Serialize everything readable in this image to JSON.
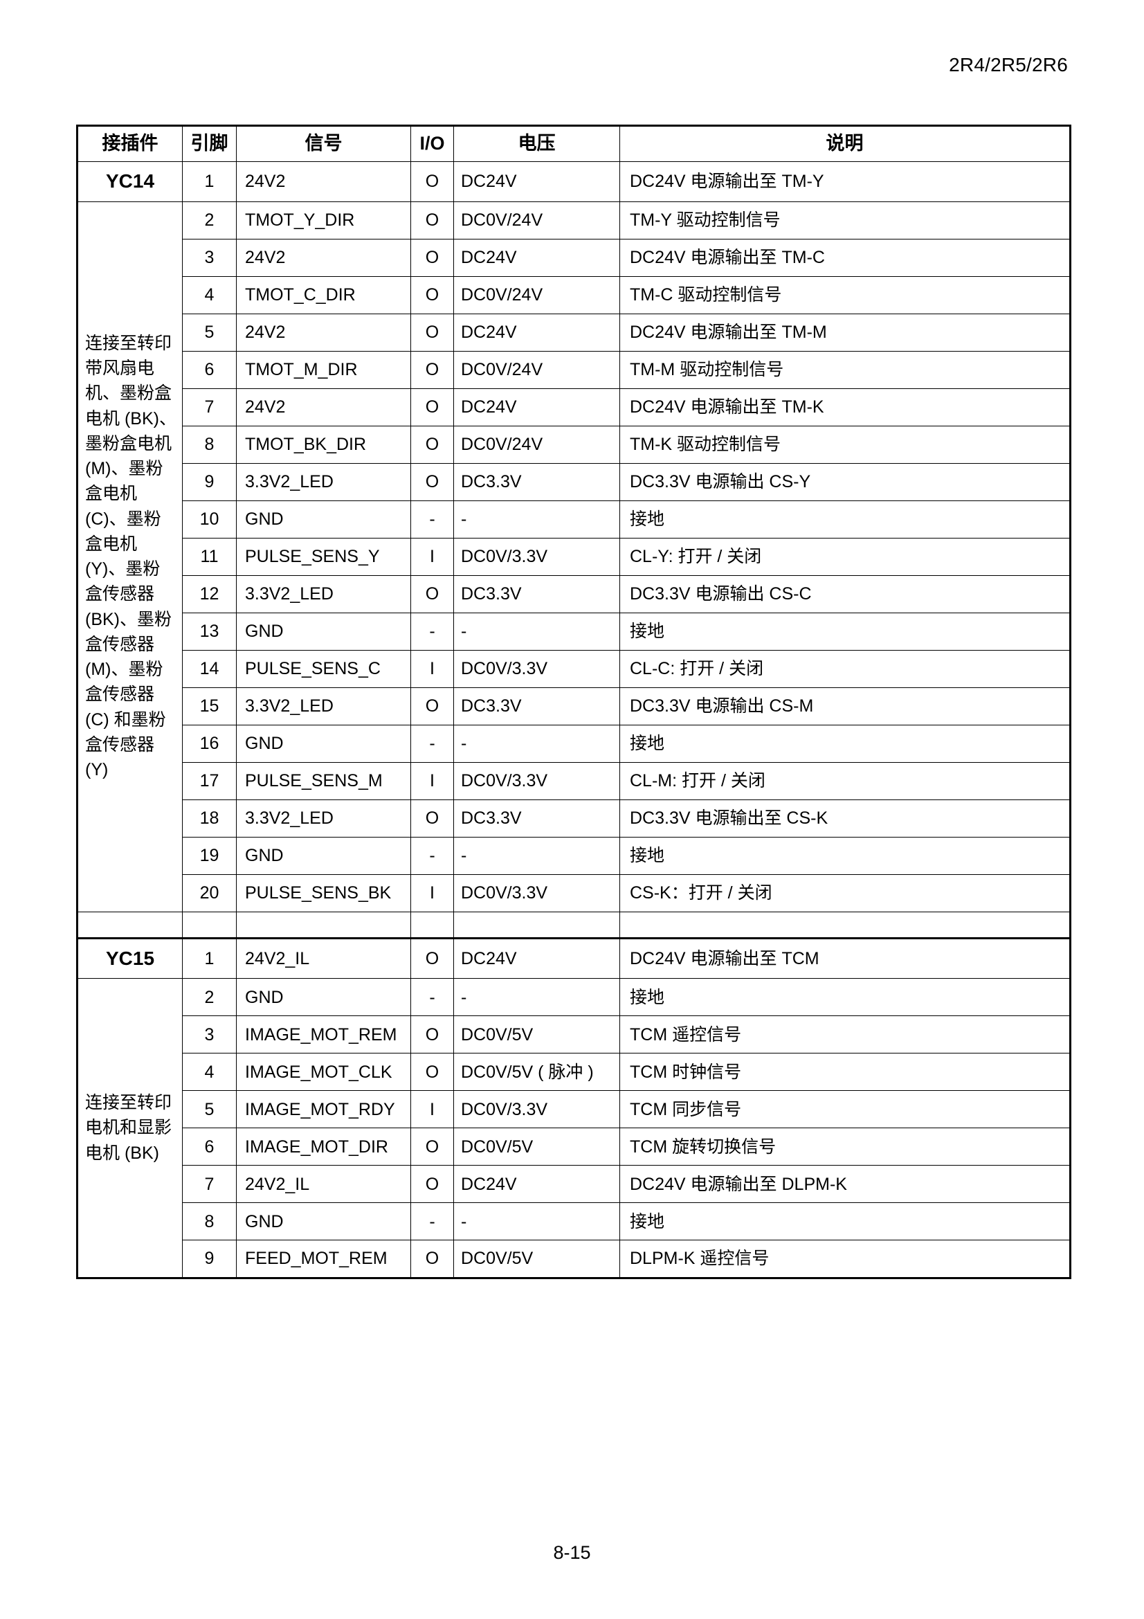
{
  "header": {
    "model_codes": "2R4/2R5/2R6"
  },
  "footer": {
    "page_number": "8-15"
  },
  "table": {
    "columns": [
      {
        "key": "connector",
        "label": "接插件"
      },
      {
        "key": "pin",
        "label": "引脚"
      },
      {
        "key": "signal",
        "label": "信号"
      },
      {
        "key": "io",
        "label": "I/O"
      },
      {
        "key": "voltage",
        "label": "电压"
      },
      {
        "key": "description",
        "label": "说明"
      }
    ],
    "blocks": [
      {
        "connector": "YC14",
        "connector_description": "连接至转印带风扇电机、墨粉盒电机 (BK)、墨粉盒电机 (M)、墨粉盒电机 (C)、墨粉盒电机 (Y)、墨粉盒传感器 (BK)、墨粉盒传感器 (M)、墨粉盒传感器 (C) 和墨粉盒传感器 (Y)",
        "rows": [
          {
            "pin": "1",
            "signal": "24V2",
            "io": "O",
            "voltage": "DC24V",
            "description": "DC24V 电源输出至 TM-Y"
          },
          {
            "pin": "2",
            "signal": "TMOT_Y_DIR",
            "io": "O",
            "voltage": "DC0V/24V",
            "description": "TM-Y 驱动控制信号"
          },
          {
            "pin": "3",
            "signal": "24V2",
            "io": "O",
            "voltage": "DC24V",
            "description": "DC24V 电源输出至 TM-C"
          },
          {
            "pin": "4",
            "signal": "TMOT_C_DIR",
            "io": "O",
            "voltage": "DC0V/24V",
            "description": "TM-C 驱动控制信号"
          },
          {
            "pin": "5",
            "signal": "24V2",
            "io": "O",
            "voltage": "DC24V",
            "description": "DC24V 电源输出至 TM-M"
          },
          {
            "pin": "6",
            "signal": "TMOT_M_DIR",
            "io": "O",
            "voltage": "DC0V/24V",
            "description": "TM-M 驱动控制信号"
          },
          {
            "pin": "7",
            "signal": "24V2",
            "io": "O",
            "voltage": "DC24V",
            "description": "DC24V 电源输出至 TM-K"
          },
          {
            "pin": "8",
            "signal": "TMOT_BK_DIR",
            "io": "O",
            "voltage": "DC0V/24V",
            "description": "TM-K 驱动控制信号"
          },
          {
            "pin": "9",
            "signal": "3.3V2_LED",
            "io": "O",
            "voltage": "DC3.3V",
            "description": "DC3.3V 电源输出 CS-Y"
          },
          {
            "pin": "10",
            "signal": "GND",
            "io": "-",
            "voltage": "-",
            "description": "接地"
          },
          {
            "pin": "11",
            "signal": "PULSE_SENS_Y",
            "io": "I",
            "voltage": "DC0V/3.3V",
            "description": "CL-Y: 打开 / 关闭"
          },
          {
            "pin": "12",
            "signal": "3.3V2_LED",
            "io": "O",
            "voltage": "DC3.3V",
            "description": "DC3.3V 电源输出 CS-C"
          },
          {
            "pin": "13",
            "signal": "GND",
            "io": "-",
            "voltage": "-",
            "description": "接地"
          },
          {
            "pin": "14",
            "signal": "PULSE_SENS_C",
            "io": "I",
            "voltage": "DC0V/3.3V",
            "description": "CL-C: 打开 / 关闭"
          },
          {
            "pin": "15",
            "signal": "3.3V2_LED",
            "io": "O",
            "voltage": "DC3.3V",
            "description": "DC3.3V 电源输出 CS-M"
          },
          {
            "pin": "16",
            "signal": "GND",
            "io": "-",
            "voltage": "-",
            "description": "接地"
          },
          {
            "pin": "17",
            "signal": "PULSE_SENS_M",
            "io": "I",
            "voltage": "DC0V/3.3V",
            "description": "CL-M: 打开 / 关闭"
          },
          {
            "pin": "18",
            "signal": "3.3V2_LED",
            "io": "O",
            "voltage": "DC3.3V",
            "description": "DC3.3V 电源输出至 CS-K"
          },
          {
            "pin": "19",
            "signal": "GND",
            "io": "-",
            "voltage": "-",
            "description": "接地"
          },
          {
            "pin": "20",
            "signal": "PULSE_SENS_BK",
            "io": "I",
            "voltage": "DC0V/3.3V",
            "description": "CS-K：打开 / 关闭"
          }
        ]
      },
      {
        "connector": "YC15",
        "connector_description": "连接至转印电机和显影电机 (BK)",
        "rows": [
          {
            "pin": "1",
            "signal": "24V2_IL",
            "io": "O",
            "voltage": "DC24V",
            "description": "DC24V 电源输出至 TCM"
          },
          {
            "pin": "2",
            "signal": "GND",
            "io": "-",
            "voltage": "-",
            "description": "接地"
          },
          {
            "pin": "3",
            "signal": "IMAGE_MOT_REM",
            "io": "O",
            "voltage": "DC0V/5V",
            "description": "TCM 遥控信号"
          },
          {
            "pin": "4",
            "signal": "IMAGE_MOT_CLK",
            "io": "O",
            "voltage": "DC0V/5V ( 脉冲 )",
            "description": "TCM 时钟信号"
          },
          {
            "pin": "5",
            "signal": "IMAGE_MOT_RDY",
            "io": "I",
            "voltage": "DC0V/3.3V",
            "description": "TCM 同步信号"
          },
          {
            "pin": "6",
            "signal": "IMAGE_MOT_DIR",
            "io": "O",
            "voltage": "DC0V/5V",
            "description": "TCM 旋转切换信号"
          },
          {
            "pin": "7",
            "signal": "24V2_IL",
            "io": "O",
            "voltage": "DC24V",
            "description": "DC24V 电源输出至 DLPM-K"
          },
          {
            "pin": "8",
            "signal": "GND",
            "io": "-",
            "voltage": "-",
            "description": "接地"
          },
          {
            "pin": "9",
            "signal": "FEED_MOT_REM",
            "io": "O",
            "voltage": "DC0V/5V",
            "description": "DLPM-K 遥控信号"
          }
        ]
      }
    ]
  }
}
